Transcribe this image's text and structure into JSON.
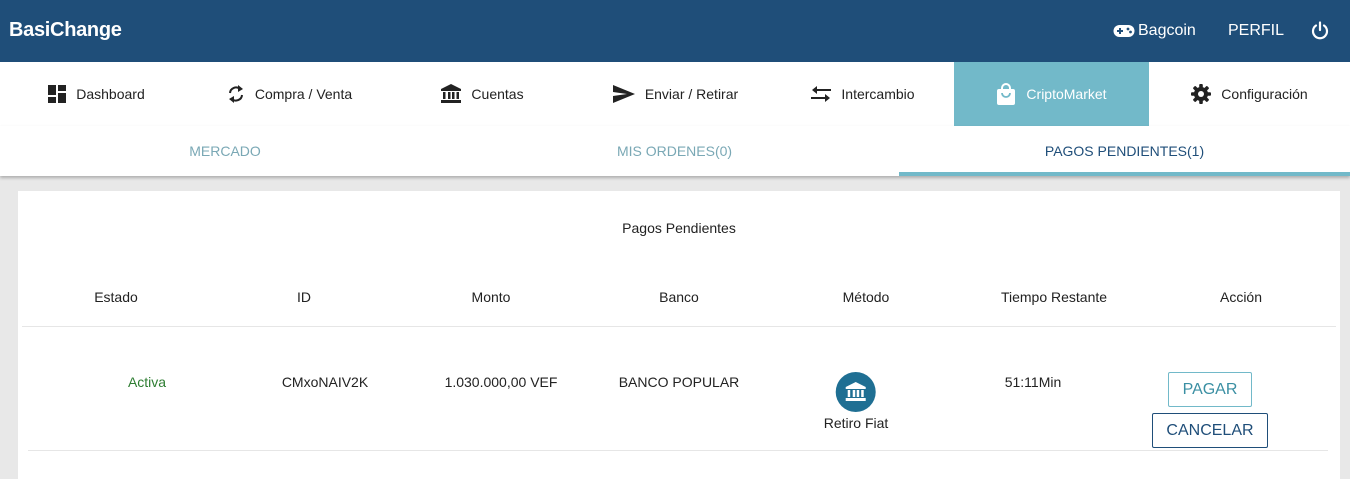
{
  "header": {
    "brand": "BasiChange",
    "bagcoin_label": "Bagcoin",
    "profile_label": "PERFIL",
    "bg_color": "#1f4e79"
  },
  "nav": {
    "items": [
      {
        "label": "Dashboard",
        "icon": "dashboard-icon"
      },
      {
        "label": "Compra / Venta",
        "icon": "refresh-icon"
      },
      {
        "label": "Cuentas",
        "icon": "bank-icon"
      },
      {
        "label": "Enviar / Retirar",
        "icon": "send-icon"
      },
      {
        "label": "Intercambio",
        "icon": "swap-icon"
      },
      {
        "label": "CriptoMarket",
        "icon": "shopping-bag-icon",
        "active": true
      },
      {
        "label": "Configuración",
        "icon": "gear-icon"
      }
    ],
    "active_color": "#72b9c9"
  },
  "subtabs": [
    {
      "label": "MERCADO"
    },
    {
      "label": "MIS ORDENES(0)"
    },
    {
      "label": "PAGOS PENDIENTES(1)",
      "active": true
    }
  ],
  "main": {
    "title": "Pagos Pendientes",
    "columns": [
      "Estado",
      "ID",
      "Monto",
      "Banco",
      "Método",
      "Tiempo Restante",
      "Acción"
    ],
    "rows": [
      {
        "estado": "Activa",
        "id": "CMxoNAIV2K",
        "monto": "1.030.000,00 VEF",
        "banco": "BANCO POPULAR",
        "metodo": "Retiro Fiat",
        "metodo_icon": "bank-icon",
        "tiempo": "51:11Min",
        "actions": {
          "pay": "PAGAR",
          "cancel": "CANCELAR"
        }
      }
    ]
  }
}
